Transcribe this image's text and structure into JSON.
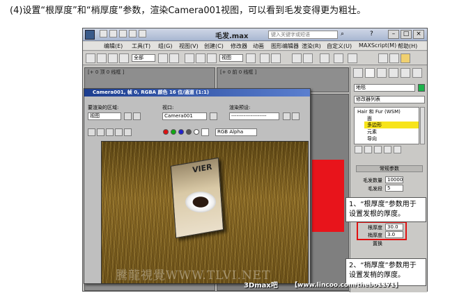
{
  "caption": "(4)设置“根厚度”和“梢厚度”参数，渲染Camera001视图，可以看到毛发变得更为粗壮。",
  "app": {
    "title": "毛发.max",
    "search_placeholder": "键入关键字或短语",
    "menu": [
      "编辑(E)",
      "工具(T)",
      "组(G)",
      "视图(V)",
      "创建(C)",
      "修改器",
      "动画",
      "图形编辑器",
      "渲染(R)",
      "自定义(U)",
      "MAXScript(M)",
      "帮助(H)"
    ],
    "selection_filter": "全部",
    "view_dropdown": "视图",
    "viewport_labels": [
      "[+ 0 顶 0 线框 ]",
      "[+ 0 前 0 线框 ]"
    ]
  },
  "command_panel": {
    "object_name": "地毯",
    "modifier_list": "修改器列表",
    "stack": [
      "Hair 和 Fur (WSM)",
      "面",
      "多边形",
      "元素",
      "导向"
    ],
    "rollout_title": "常规参数",
    "params": [
      {
        "label": "毛发数量",
        "value": "10000"
      },
      {
        "label": "毛发段",
        "value": "5"
      },
      {
        "label": "根厚度",
        "value": "30.0"
      },
      {
        "label": "梢厚度",
        "value": "3.0"
      },
      {
        "label": "置换",
        "value": "0.0"
      }
    ]
  },
  "render_window": {
    "title": "Camera001, 帧 0, RGBA 颜色 16 位/通道 (1:1)",
    "area_label": "要渲染的区域:",
    "area_value": "视图",
    "viewport_label": "视口:",
    "viewport_value": "Camera001",
    "preset_label": "渲染预设:",
    "preset_value": "--------------------",
    "channel_value": "RGB Alpha",
    "book_title": "VIER",
    "watermark": "騰龍視覺WWW.TLVI.NET"
  },
  "callouts": {
    "root": "1、“根厚度”参数用于设置发根的厚度。",
    "tip": "2、“梢厚度”参数用于设置发梢的厚度。"
  },
  "footer": {
    "brand": "3Dmax吧",
    "url": "【www.lincoo.com/thebo1171】"
  },
  "colors": {
    "accent": "#e01010",
    "viewport_red": "#e8141b",
    "render_titlebar": "#1c3d8f"
  }
}
